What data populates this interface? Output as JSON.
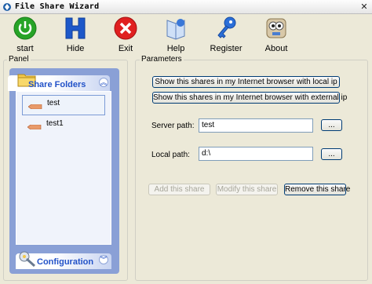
{
  "window": {
    "title": "File Share Wizard",
    "close_glyph": "✕"
  },
  "toolbar": {
    "start": "start",
    "hide": "Hide",
    "exit": "Exit",
    "help": "Help",
    "register": "Register",
    "about": "About"
  },
  "panel": {
    "caption": "Panel",
    "share_folders": {
      "title": "Share Folders",
      "items": [
        "test",
        "test1"
      ],
      "selected_index": 0
    },
    "configuration": {
      "title": "Configuration"
    }
  },
  "parameters": {
    "caption": "Parameters",
    "show_local_btn": "Show this shares in my Internet browser with local ip",
    "show_external_btn": "Show this shares in my Internet browser with external ip",
    "server_path_label": "Server path:",
    "server_path_value": "test",
    "local_path_label": "Local path:",
    "local_path_value": "d:\\",
    "browse_label": "...",
    "add_share": "Add this share",
    "modify_share": "Modify this share",
    "remove_share": "Remove this share"
  },
  "colors": {
    "panel_blue": "#8aa0d6",
    "header_text": "#2252c8",
    "window_bg": "#ECE9D8"
  },
  "icons": [
    "power-icon",
    "hide-h-icon",
    "exit-x-icon",
    "help-book-icon",
    "register-key-icon",
    "about-owl-icon",
    "folder-icon",
    "share-pencil-icon",
    "wrench-icon"
  ]
}
